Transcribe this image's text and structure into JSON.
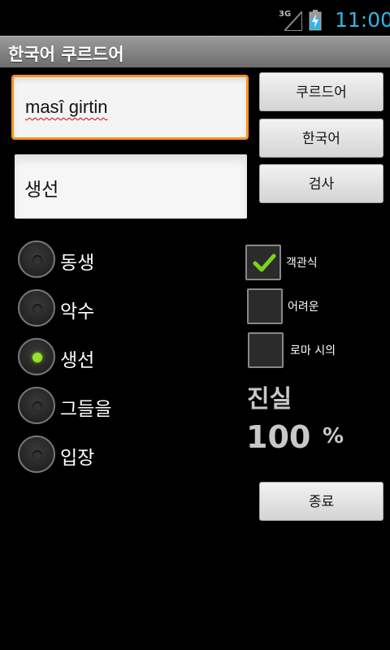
{
  "status": {
    "network": "3G",
    "time": "11:00"
  },
  "app": {
    "title": "한국어 쿠르드어"
  },
  "input": {
    "value": "masî girtin"
  },
  "output": {
    "value": "생선"
  },
  "buttons": {
    "kurdish": "쿠르드어",
    "korean": "한국어",
    "check": "검사",
    "exit": "종료"
  },
  "options": [
    {
      "label": "동생",
      "selected": false
    },
    {
      "label": "악수",
      "selected": false
    },
    {
      "label": "생선",
      "selected": true
    },
    {
      "label": "그들을",
      "selected": false
    },
    {
      "label": "입장",
      "selected": false
    }
  ],
  "checkboxes": [
    {
      "label": "객관식",
      "checked": true
    },
    {
      "label": "어려운",
      "checked": false
    },
    {
      "label": "로마 시의",
      "checked": false
    }
  ],
  "result": {
    "word": "진실",
    "score": "100",
    "unit": "%"
  },
  "colors": {
    "accent": "#33b5e5",
    "focus": "#f7931e",
    "radio_on": "#97e02f",
    "check": "#7fd11f"
  }
}
